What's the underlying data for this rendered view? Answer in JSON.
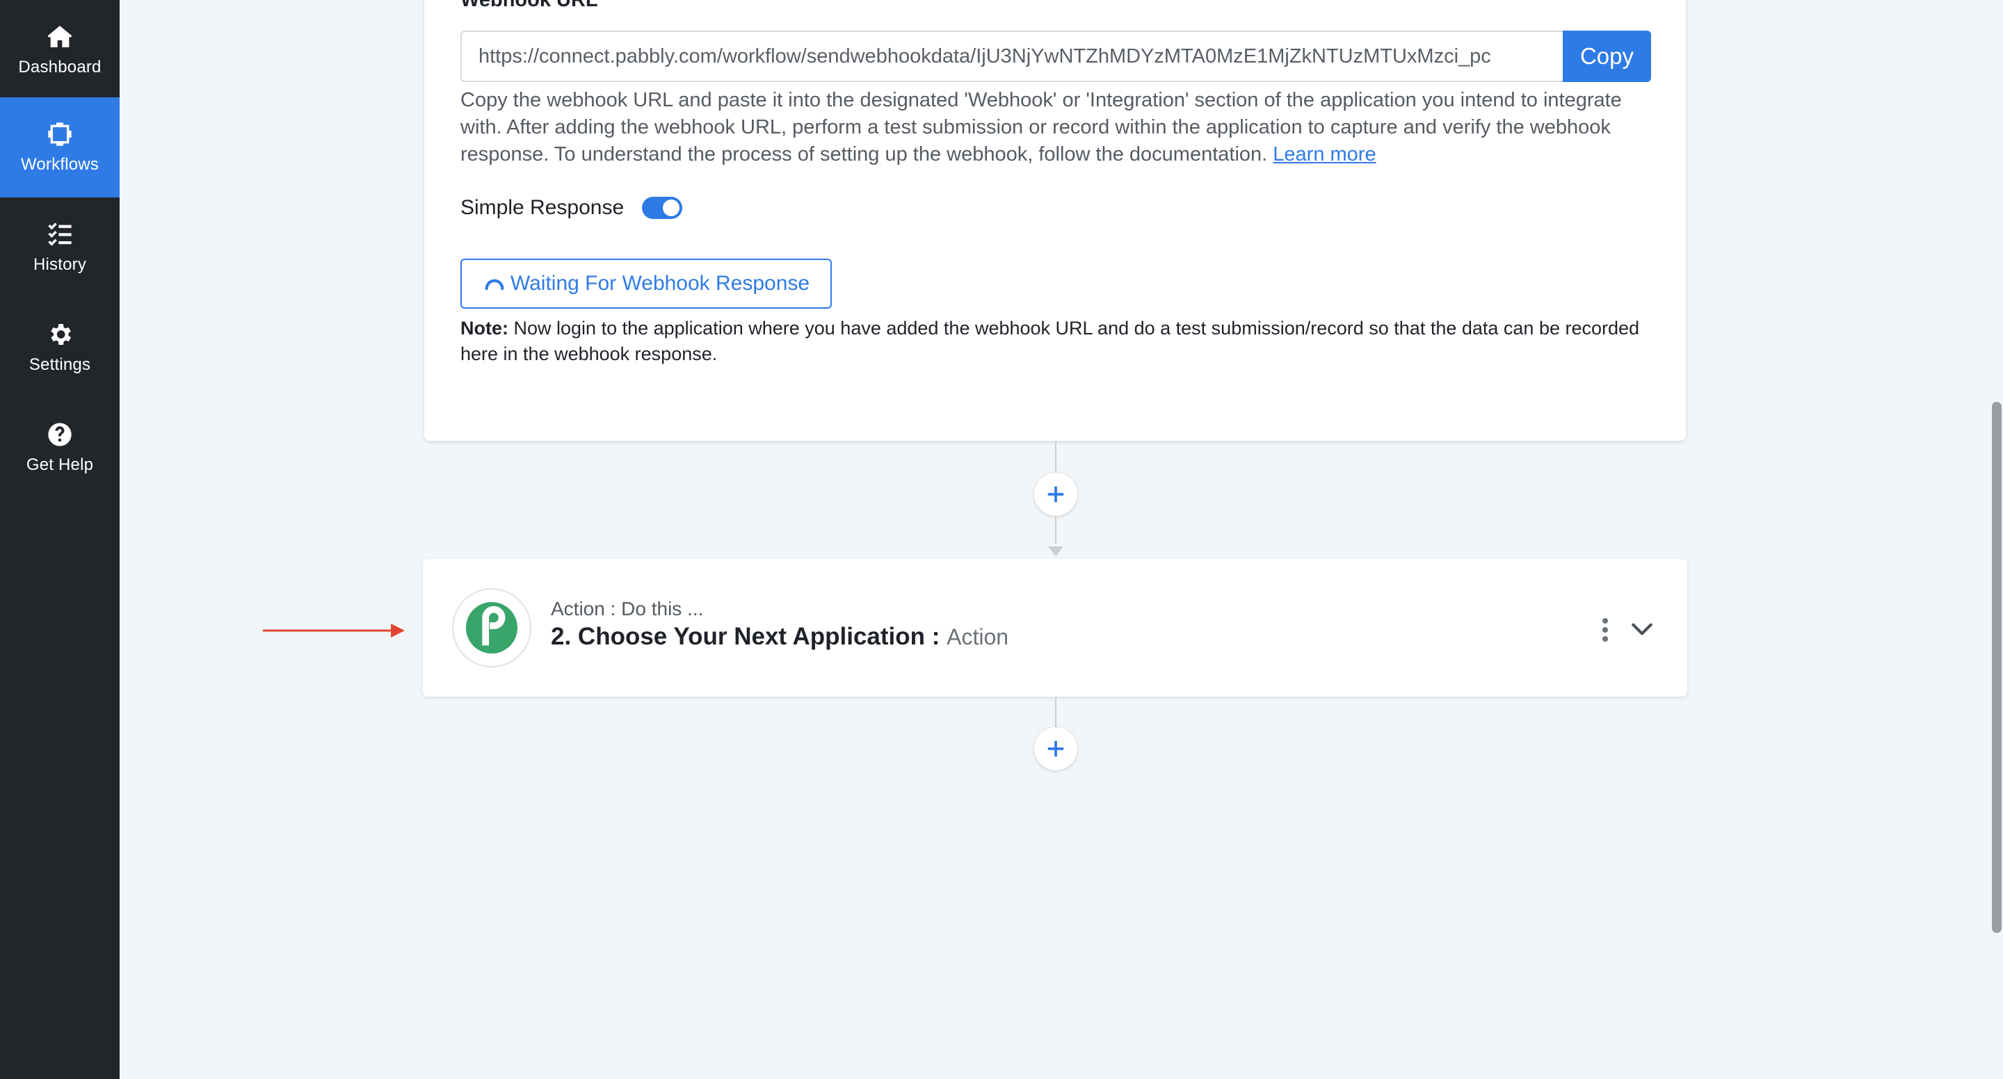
{
  "sidebar": {
    "items": [
      {
        "label": "Dashboard",
        "icon": "home-icon",
        "active": false
      },
      {
        "label": "Workflows",
        "icon": "workflow-icon",
        "active": true
      },
      {
        "label": "History",
        "icon": "list-check-icon",
        "active": false
      },
      {
        "label": "Settings",
        "icon": "gear-icon",
        "active": false
      },
      {
        "label": "Get Help",
        "icon": "question-circle-icon",
        "active": false
      }
    ]
  },
  "webhook": {
    "label": "Webhook URL",
    "url": "https://connect.pabbly.com/workflow/sendwebhookdata/IjU3NjYwNTZhMDYzMTA0MzE1MjZkNTUzMTUxMzci_pc",
    "copy_label": "Copy",
    "help_text": "Copy the webhook URL and paste it into the designated 'Webhook' or 'Integration' section of the application you intend to integrate with. After adding the webhook URL, perform a test submission or record within the application to capture and verify the webhook response. To understand the process of setting up the webhook, follow the documentation.",
    "learn_more": "Learn more",
    "simple_response_label": "Simple Response",
    "simple_response_on": true,
    "waiting_label": "Waiting For Webhook Response",
    "note_label": "Note:",
    "note_text": "Now login to the application where you have added the webhook URL and do a test submission/record so that the data can be recorded here in the webhook response."
  },
  "action_step": {
    "subtitle": "Action : Do this ...",
    "title": "2. Choose Your Next Application :",
    "kind": "Action",
    "logo_icon": "pabbly-logo-icon"
  },
  "colors": {
    "accent": "#2f7be6",
    "sidebar_bg": "#22262b",
    "annotation": "#e0462f"
  }
}
